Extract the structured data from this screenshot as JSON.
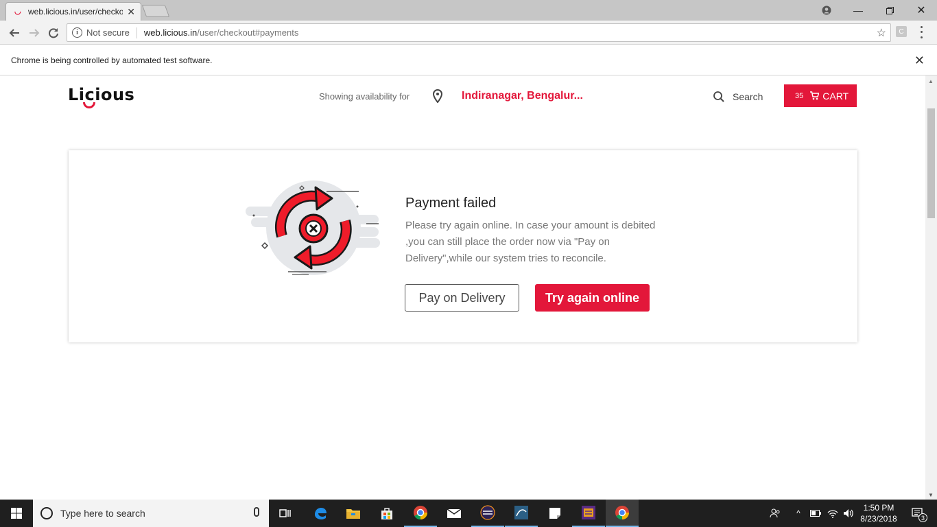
{
  "browser": {
    "tab_title": "web.licious.in/user/checko",
    "security_label": "Not secure",
    "url_host": "web.licious.in",
    "url_path": "/user/checkout#payments",
    "ext_letter": "C",
    "infobar_text": "Chrome is being controlled by automated test software."
  },
  "header": {
    "availability_label": "Showing availability for",
    "location": "Indiranagar, Bengalur...",
    "search_label": "Search",
    "cart_count": "35",
    "cart_label": "CART"
  },
  "payment": {
    "title": "Payment failed",
    "message": "Please try again online. In case your amount is debited ,you can still place the order now via \"Pay on Delivery\",while our system tries to reconcile.",
    "cod_button": "Pay on Delivery",
    "retry_button": "Try again online"
  },
  "taskbar": {
    "search_placeholder": "Type here to search",
    "time": "1:50 PM",
    "date": "8/23/2018",
    "notification_count": "3"
  },
  "colors": {
    "brand_red": "#e3173a",
    "taskbar": "#1f1f1f"
  }
}
